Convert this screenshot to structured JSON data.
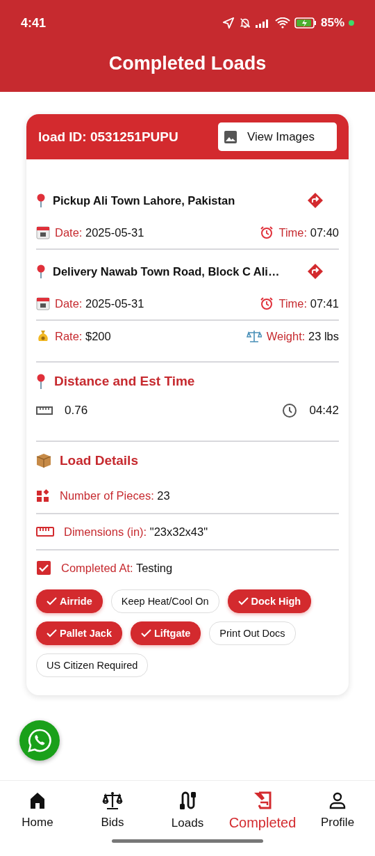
{
  "status_bar": {
    "time": "4:41",
    "battery": "85%"
  },
  "app_bar": {
    "title": "Completed Loads"
  },
  "load": {
    "id_text": "load ID: 0531251PUPU",
    "view_images_button": "View Images"
  },
  "stops": [
    {
      "address": "Pickup Ali Town Lahore, Pakistan",
      "date_label": "Date:",
      "date": "2025-05-31",
      "time_label": "Time:",
      "time": "07:40"
    },
    {
      "address": "Delivery Nawab Town Road, Block C Ali…",
      "date_label": "Date:",
      "date": "2025-05-31",
      "time_label": "Time:",
      "time": "07:41"
    }
  ],
  "rate": {
    "label": "Rate:",
    "value": "$200"
  },
  "weight": {
    "label": "Weight:",
    "value": "23 lbs"
  },
  "distance_section": {
    "title": "Distance and Est Time",
    "distance": "0.76",
    "duration": "04:42"
  },
  "load_details": {
    "title": "Load Details",
    "rows": [
      {
        "kind": "pieces",
        "label": "Number of Pieces:",
        "value": "23"
      },
      {
        "kind": "dimensions",
        "label": "Dimensions (in):",
        "value": "\"23x32x43\""
      },
      {
        "kind": "completed",
        "label": "Completed At:",
        "value": "Testing"
      }
    ]
  },
  "tags": [
    {
      "label": "Airride",
      "selected": true
    },
    {
      "label": "Keep Heat/Cool On",
      "selected": false
    },
    {
      "label": "Dock High",
      "selected": true
    },
    {
      "label": "Pallet Jack",
      "selected": true
    },
    {
      "label": "Liftgate",
      "selected": true
    },
    {
      "label": "Print Out Docs",
      "selected": false
    },
    {
      "label": "US Citizen Required",
      "selected": false
    }
  ],
  "bottom_nav": [
    {
      "kind": "home",
      "label": "Home",
      "selected": false
    },
    {
      "kind": "bids",
      "label": "Bids",
      "selected": false
    },
    {
      "kind": "loads",
      "label": "Loads",
      "selected": false
    },
    {
      "kind": "completed",
      "label": "Completed",
      "selected": true
    },
    {
      "kind": "profile",
      "label": "Profile",
      "selected": false
    }
  ]
}
